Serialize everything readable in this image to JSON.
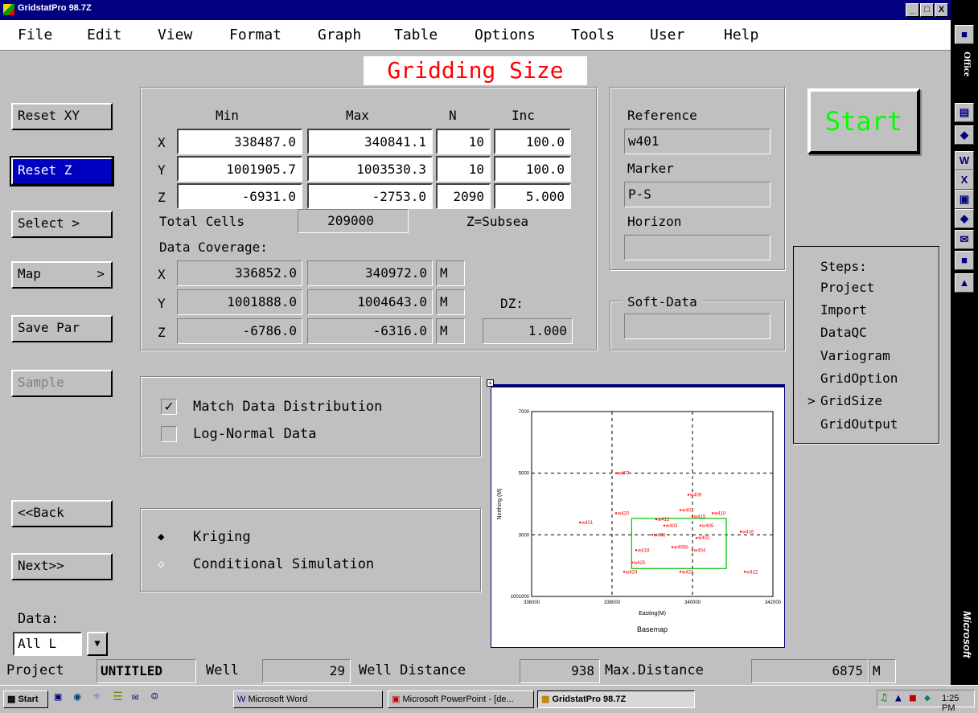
{
  "window": {
    "title": "GridstatPro 98.7Z",
    "min": "_",
    "max": "□",
    "close": "X"
  },
  "menu": [
    "File",
    "Edit",
    "View",
    "Format",
    "Graph",
    "Table",
    "Options",
    "Tools",
    "User",
    "Help"
  ],
  "page_title": "Gridding Size",
  "left_buttons": {
    "reset_xy": "Reset XY",
    "reset_z": "Reset Z",
    "select": "Select >",
    "map": "Map",
    "map_arrow": ">",
    "save_par": "Save Par",
    "sample": "Sample",
    "back": "<<Back",
    "next": "Next>>"
  },
  "grid": {
    "headers": {
      "min": "Min",
      "max": "Max",
      "n": "N",
      "inc": "Inc"
    },
    "rows": [
      {
        "axis": "X",
        "min": "338487.0",
        "max": "340841.1",
        "n": "10",
        "inc": "100.0"
      },
      {
        "axis": "Y",
        "min": "1001905.7",
        "max": "1003530.3",
        "n": "10",
        "inc": "100.0"
      },
      {
        "axis": "Z",
        "min": "-6931.0",
        "max": "-2753.0",
        "n": "2090",
        "inc": "5.000"
      }
    ],
    "total_cells_label": "Total Cells",
    "total_cells": "209000",
    "z_mode": "Z=Subsea",
    "coverage_label": "Data Coverage:",
    "coverage": [
      {
        "axis": "X",
        "min": "336852.0",
        "max": "340972.0",
        "unit": "M"
      },
      {
        "axis": "Y",
        "min": "1001888.0",
        "max": "1004643.0",
        "unit": "M"
      },
      {
        "axis": "Z",
        "min": "-6786.0",
        "max": "-6316.0",
        "unit": "M"
      }
    ],
    "dz_label": "DZ:",
    "dz": "1.000"
  },
  "reference": {
    "label": "Reference",
    "value": "w401",
    "marker_label": "Marker",
    "marker": "P-S",
    "horizon_label": "Horizon",
    "horizon": ""
  },
  "soft_data": {
    "label": "Soft-Data",
    "value": ""
  },
  "start": "Start",
  "steps": {
    "title": "Steps:",
    "items": [
      "Project",
      "Import",
      "DataQC",
      "Variogram",
      "GridOption",
      "GridSize",
      "GridOutput"
    ],
    "current_marker": ">",
    "current": "GridSize"
  },
  "options": {
    "match": "Match Data Distribution",
    "match_checked": true,
    "lognormal": "Log-Normal Data",
    "lognormal_checked": false
  },
  "method": {
    "kriging": "Kriging",
    "kriging_selected": true,
    "sim": "Conditional Simulation"
  },
  "data_filter": {
    "label": "Data:",
    "value": "All L"
  },
  "status": {
    "project_label": "Project",
    "project": "UNTITLED",
    "well_label": "Well",
    "well": "29",
    "distance_label": "Well Distance",
    "distance": "938",
    "maxdist_label": "Max.Distance",
    "maxdist": "6875",
    "unit": "M"
  },
  "taskbar": {
    "start": "Start",
    "word": "Microsoft Word",
    "ppt": "Microsoft PowerPoint - [de...",
    "gsp": "GridstatPro 98.7Z",
    "clock": "1:25 PM"
  },
  "office": {
    "label": "Office",
    "brand": "Microsoft"
  },
  "colors": {
    "title_bar": "#000080",
    "accent_red": "#ff0000",
    "start_green": "#00ff00",
    "selection": "#0000c0"
  },
  "chart_data": {
    "type": "scatter",
    "title": "",
    "xlabel": "Easting(M)",
    "ylabel": "Northing (M)",
    "caption": "Basemap",
    "xlim": [
      336000,
      342000
    ],
    "ylim": [
      1001000,
      1007000
    ],
    "xticks": [
      "336000",
      "338000",
      "340000",
      "342000"
    ],
    "yticks": [
      "1001000",
      "3000",
      "5000",
      "7000"
    ],
    "grid": true,
    "points": [
      {
        "label": "w409",
        "x": 339900,
        "y": 1004300
      },
      {
        "label": "w407",
        "x": 338100,
        "y": 1005000
      },
      {
        "label": "w401",
        "x": 339700,
        "y": 1003800
      },
      {
        "label": "w420",
        "x": 338100,
        "y": 1003700
      },
      {
        "label": "w421",
        "x": 337200,
        "y": 1003400
      },
      {
        "label": "w412",
        "x": 339100,
        "y": 1003500
      },
      {
        "label": "w415",
        "x": 340000,
        "y": 1003600
      },
      {
        "label": "w410",
        "x": 340500,
        "y": 1003700
      },
      {
        "label": "w403",
        "x": 339300,
        "y": 1003300
      },
      {
        "label": "w405",
        "x": 340200,
        "y": 1003300
      },
      {
        "label": "w416",
        "x": 341200,
        "y": 1003100
      },
      {
        "label": "w408",
        "x": 339000,
        "y": 1003000
      },
      {
        "label": "w402",
        "x": 340100,
        "y": 1002900
      },
      {
        "label": "w418",
        "x": 338600,
        "y": 1002500
      },
      {
        "label": "w405b",
        "x": 339500,
        "y": 1002600
      },
      {
        "label": "w404",
        "x": 340000,
        "y": 1002500
      },
      {
        "label": "w425",
        "x": 338500,
        "y": 1002100
      },
      {
        "label": "w424",
        "x": 338300,
        "y": 1001800
      },
      {
        "label": "w423",
        "x": 339700,
        "y": 1001800
      },
      {
        "label": "w422",
        "x": 341300,
        "y": 1001800
      }
    ],
    "box": {
      "xmin": 338487.0,
      "xmax": 340841.1,
      "ymin": 1001905.7,
      "ymax": 1003530.3
    }
  }
}
